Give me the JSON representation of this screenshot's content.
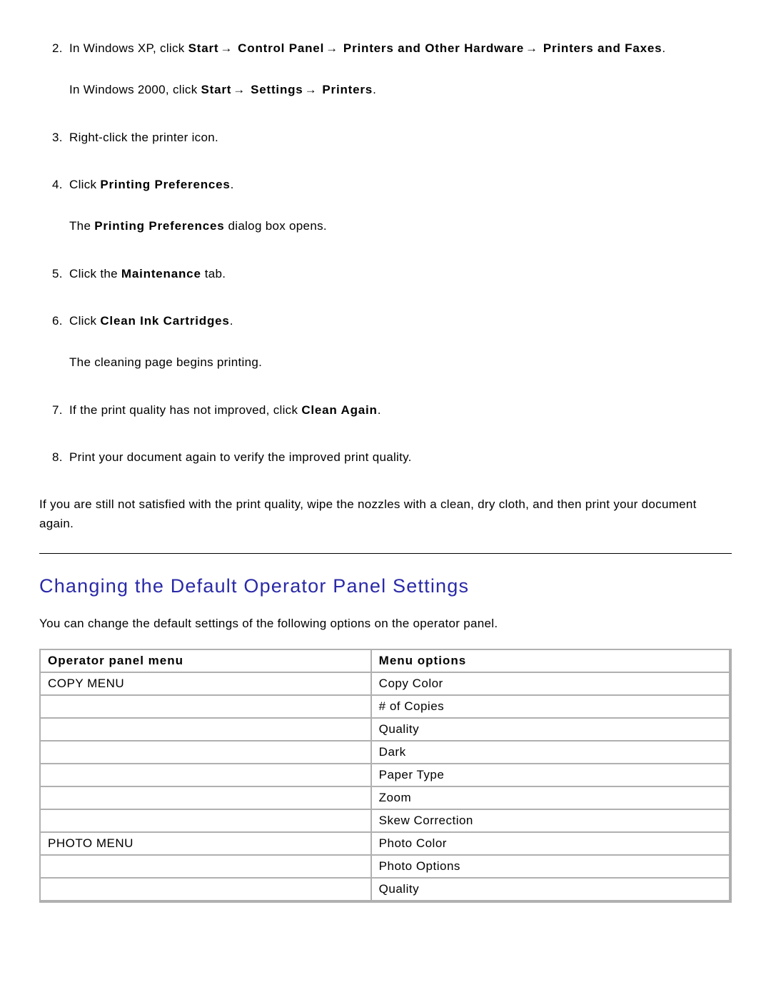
{
  "steps": [
    {
      "num": "2.",
      "parts": [
        {
          "t": "In Windows XP, click "
        },
        {
          "t": "Start",
          "b": true
        },
        {
          "arrow": true
        },
        {
          "t": " Control Panel",
          "b": true
        },
        {
          "arrow": true
        },
        {
          "t": " Printers and Other Hardware",
          "b": true
        },
        {
          "arrow": true
        },
        {
          "t": " Printers and Faxes",
          "b": true
        },
        {
          "t": "."
        }
      ],
      "sub": [
        {
          "t": "In Windows 2000, click "
        },
        {
          "t": "Start",
          "b": true
        },
        {
          "arrow": true
        },
        {
          "t": " Settings",
          "b": true
        },
        {
          "arrow": true
        },
        {
          "t": " Printers",
          "b": true
        },
        {
          "t": "."
        }
      ]
    },
    {
      "num": "3.",
      "parts": [
        {
          "t": "Right-click the printer icon."
        }
      ]
    },
    {
      "num": "4.",
      "parts": [
        {
          "t": "Click "
        },
        {
          "t": "Printing Preferences",
          "b": true
        },
        {
          "t": "."
        }
      ],
      "sub": [
        {
          "t": "The "
        },
        {
          "t": "Printing Preferences",
          "b": true
        },
        {
          "t": " dialog box opens."
        }
      ]
    },
    {
      "num": "5.",
      "parts": [
        {
          "t": "Click the "
        },
        {
          "t": "Maintenance",
          "b": true
        },
        {
          "t": " tab."
        }
      ]
    },
    {
      "num": "6.",
      "parts": [
        {
          "t": "Click "
        },
        {
          "t": "Clean Ink Cartridges",
          "b": true
        },
        {
          "t": "."
        }
      ],
      "sub": [
        {
          "t": "The cleaning page begins printing."
        }
      ]
    },
    {
      "num": "7.",
      "parts": [
        {
          "t": "If the print quality has not improved, click "
        },
        {
          "t": "Clean Again",
          "b": true
        },
        {
          "t": "."
        }
      ]
    },
    {
      "num": "8.",
      "parts": [
        {
          "t": "Print your document again to verify the improved print quality."
        }
      ]
    }
  ],
  "closing": "If you are still not satisfied with the print quality, wipe the nozzles with a clean, dry cloth, and then print your document again.",
  "heading": "Changing the Default Operator Panel Settings",
  "intro": "You can change the default settings of the following options on the operator panel.",
  "table": {
    "head1": "Operator panel menu",
    "head2": "Menu options",
    "rows": [
      {
        "menu": "COPY MENU",
        "opt": "Copy Color"
      },
      {
        "menu": "",
        "opt": "# of Copies"
      },
      {
        "menu": "",
        "opt": "Quality"
      },
      {
        "menu": "",
        "opt": "Dark"
      },
      {
        "menu": "",
        "opt": "Paper Type"
      },
      {
        "menu": "",
        "opt": "Zoom"
      },
      {
        "menu": "",
        "opt": "Skew Correction"
      },
      {
        "menu": "PHOTO MENU",
        "opt": "Photo Color"
      },
      {
        "menu": "",
        "opt": "Photo Options"
      },
      {
        "menu": "",
        "opt": "Quality"
      }
    ]
  },
  "arrow_glyph": "→"
}
